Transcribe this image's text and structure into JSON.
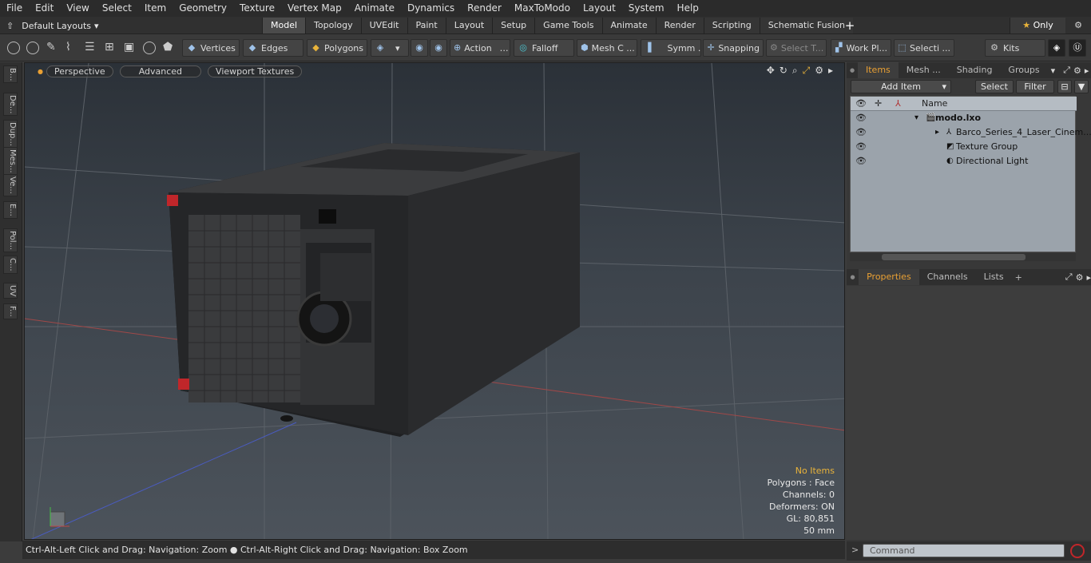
{
  "menu": [
    "File",
    "Edit",
    "View",
    "Select",
    "Item",
    "Geometry",
    "Texture",
    "Vertex Map",
    "Animate",
    "Dynamics",
    "Render",
    "MaxToModo",
    "Layout",
    "System",
    "Help"
  ],
  "layout_selector": "Default Layouts",
  "tabs": [
    "Model",
    "Topology",
    "UVEdit",
    "Paint",
    "Layout",
    "Setup",
    "Game Tools",
    "Animate",
    "Render",
    "Scripting",
    "Schematic Fusion"
  ],
  "active_tab": "Model",
  "tab_add": "+",
  "only_label": "Only",
  "toolbar": {
    "vertices": "Vertices",
    "edges": "Edges",
    "polygons": "Polygons",
    "action": "Action",
    "falloff": "Falloff",
    "mesh": "Mesh C ...",
    "symm": "Symm ...",
    "snapping": "Snapping",
    "select_t": "Select T...",
    "work_pl": "Work Pl...",
    "selecti": "Selecti ...",
    "kits": "Kits"
  },
  "left_tabs": [
    "B...",
    "De...",
    "Dup...",
    "Mes...",
    "Ve...",
    "E...",
    "Pol...",
    "C...",
    "UV",
    "F..."
  ],
  "viewport": {
    "perspective": "Perspective",
    "advanced": "Advanced",
    "viewport_textures": "Viewport Textures"
  },
  "stats": {
    "no_items": "No Items",
    "polygons": "Polygons : Face",
    "channels": "Channels: 0",
    "deformers": "Deformers: ON",
    "gl": "GL: 80,851",
    "scale": "50 mm"
  },
  "status_text": "Ctrl-Alt-Left Click and Drag: Navigation: Zoom ● Ctrl-Alt-Right Click and Drag: Navigation: Box Zoom",
  "items_panel": {
    "tabs": [
      "Items",
      "Mesh ...",
      "Shading",
      "Groups"
    ],
    "add_item": "Add Item",
    "select": "Select",
    "filter": "Filter",
    "col_name": "Name",
    "tree": [
      {
        "label": "modo.lxo",
        "depth": 0,
        "bold": true
      },
      {
        "label": "Barco_Series_4_Laser_Cinem...",
        "depth": 1,
        "bold": false
      },
      {
        "label": "Texture Group",
        "depth": 1,
        "bold": false
      },
      {
        "label": "Directional Light",
        "depth": 1,
        "bold": false
      }
    ]
  },
  "props_panel": {
    "tabs": [
      "Properties",
      "Channels",
      "Lists"
    ],
    "add": "+"
  },
  "command_placeholder": "Command",
  "colors": {
    "accent": "#e9a033",
    "viewport_top": "#2b3138",
    "tree_bg": "#9ba3ab"
  }
}
